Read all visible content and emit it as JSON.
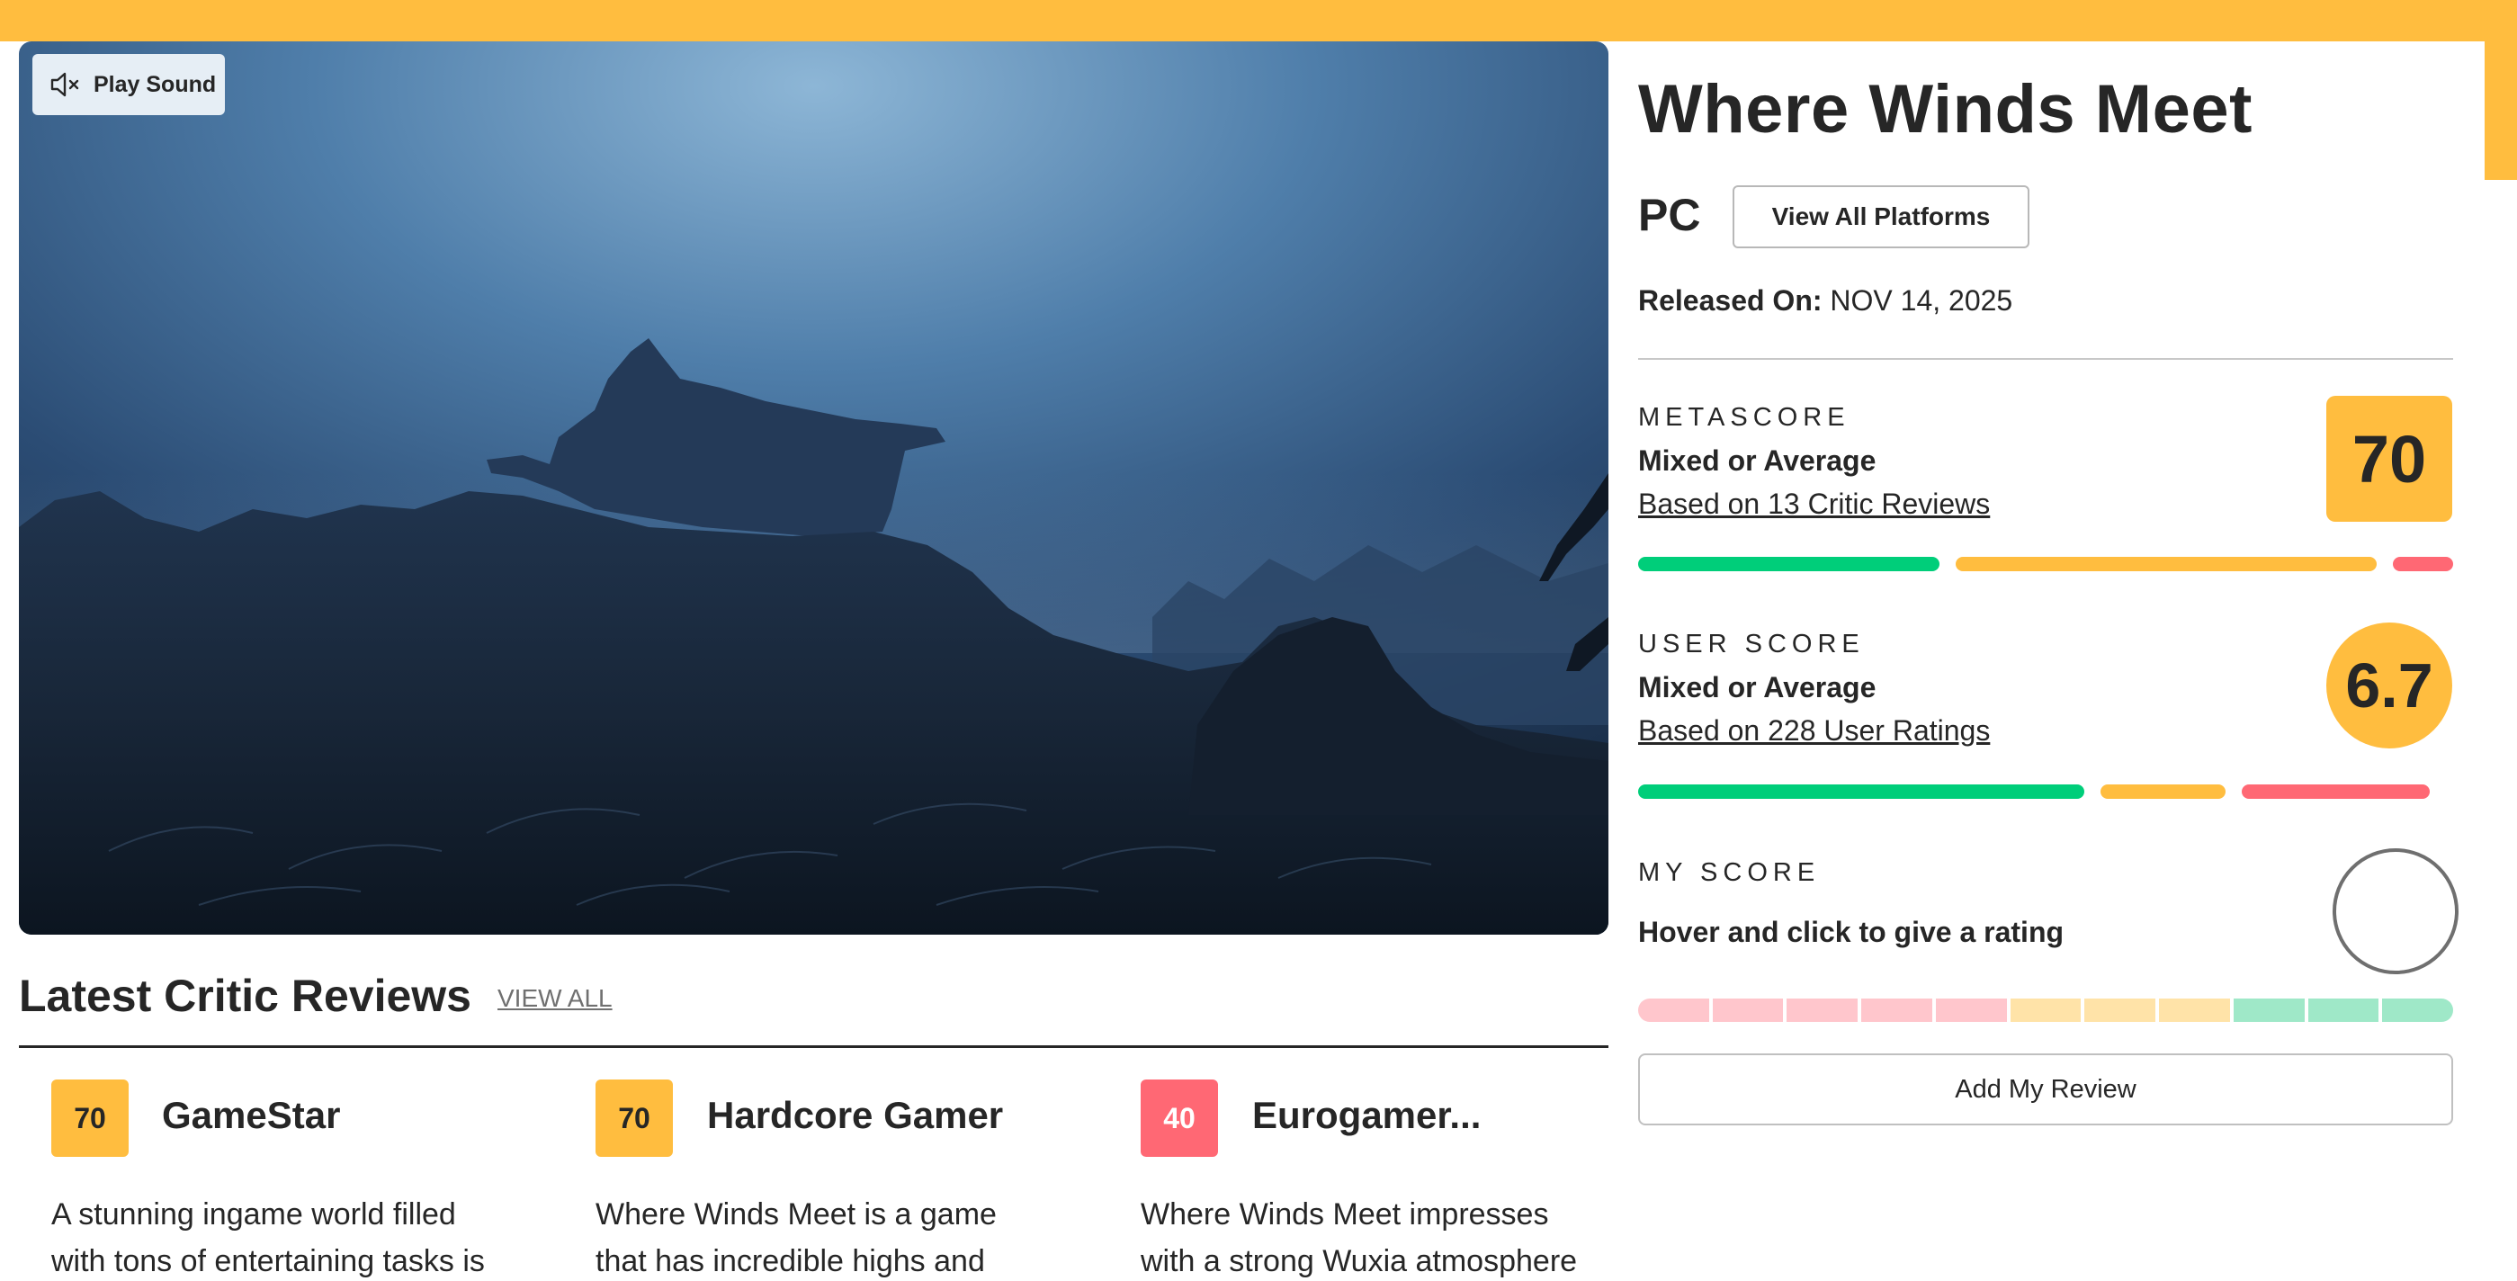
{
  "colors": {
    "accent_yellow": "#ffbd3f",
    "positive_green": "#00ce7a",
    "negative_red": "#ff6874",
    "text_dark": "#262626"
  },
  "hero": {
    "sound_button_label": "Play Sound",
    "sound_icon": "speaker-muted-icon"
  },
  "game": {
    "title": "Where Winds Meet",
    "platform": "PC",
    "view_platforms_label": "View All Platforms",
    "released_label": "Released On:",
    "released_date": "NOV 14, 2025"
  },
  "metascore": {
    "label": "METASCORE",
    "score": "70",
    "sentiment": "Mixed or Average",
    "based_on": "Based on 13 Critic Reviews",
    "distribution": {
      "positive": 0.385,
      "mixed": 0.538,
      "negative": 0.077
    }
  },
  "user_score": {
    "label": "USER SCORE",
    "score": "6.7",
    "sentiment": "Mixed or Average",
    "based_on": "Based on 228 User Ratings",
    "distribution": {
      "positive": 0.57,
      "mixed": 0.16,
      "negative": 0.24
    }
  },
  "my_score": {
    "label": "MY SCORE",
    "prompt": "Hover and click to give a rating",
    "segments": 11,
    "add_review_label": "Add My Review"
  },
  "critic_reviews": {
    "heading": "Latest Critic Reviews",
    "view_all_label": "VIEW ALL",
    "items": [
      {
        "score": "70",
        "publication": "GameStar",
        "line1": "A stunning ingame world filled",
        "line2": "with tons of entertaining tasks is",
        "tone": "mixed"
      },
      {
        "score": "70",
        "publication": "Hardcore Gamer",
        "line1": "Where Winds Meet is a game",
        "line2": "that has incredible highs and",
        "tone": "mixed"
      },
      {
        "score": "40",
        "publication": "Eurogamer...",
        "line1": "Where Winds Meet impresses",
        "line2": "with a strong Wuxia atmosphere",
        "tone": "negative"
      }
    ]
  }
}
